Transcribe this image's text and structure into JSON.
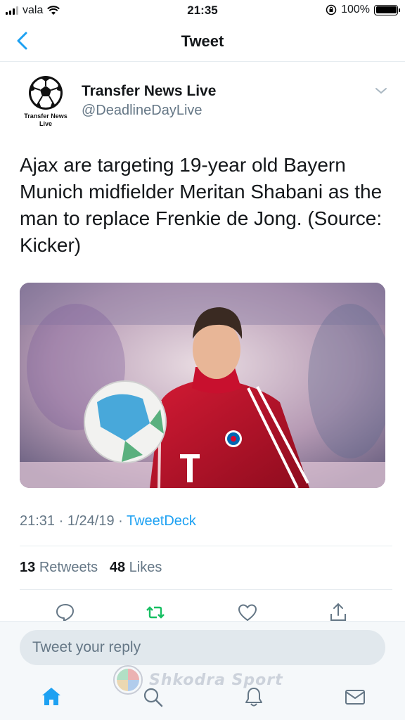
{
  "status_bar": {
    "carrier": "vala",
    "time": "21:35",
    "battery": "100%",
    "battery_level": 1.0
  },
  "nav": {
    "title": "Tweet",
    "back_icon": "chevron-left-icon"
  },
  "tweet": {
    "author_name": "Transfer News Live",
    "author_handle": "@DeadlineDayLive",
    "avatar_caption": "Transfer News Live",
    "text": "Ajax are targeting 19-year old Bayern Munich midfielder Meritan Shabani as the man to replace Frenkie de Jong. (Source: Kicker)",
    "time": "21:31",
    "date": "1/24/19",
    "source": "TweetDeck",
    "retweet_count": "13",
    "retweet_label": "Retweets",
    "like_count": "48",
    "like_label": "Likes"
  },
  "actions": [
    "reply-icon",
    "retweet-icon",
    "like-icon",
    "share-icon"
  ],
  "reply": {
    "placeholder": "Tweet your reply"
  },
  "watermark": {
    "text": "Shkodra Sport"
  },
  "tab_bar": [
    "home-icon",
    "search-icon",
    "notifications-icon",
    "messages-icon"
  ],
  "colors": {
    "accent": "#1da1f2",
    "retweet": "#17bf63",
    "secondary_text": "#657786",
    "jersey": "#c8102e"
  }
}
